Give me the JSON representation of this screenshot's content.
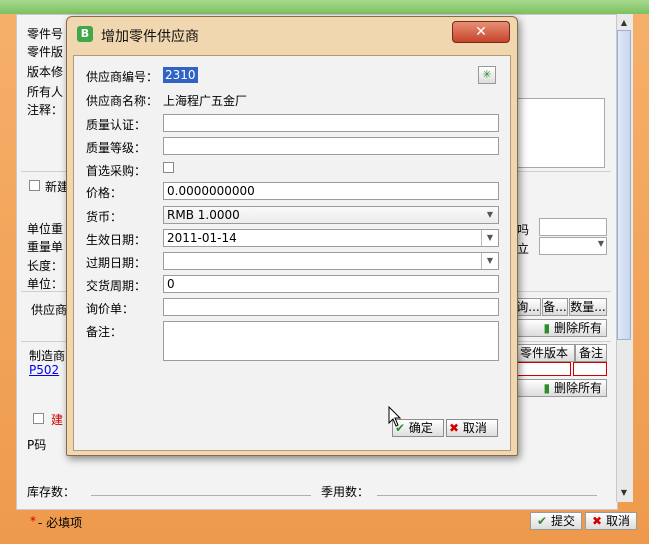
{
  "background": {
    "labels": {
      "part_no": "零件号",
      "part_version": "零件版",
      "version_note": "版本修",
      "owner": "所有人",
      "remark": "注释：",
      "new_build": "新建",
      "unit_weight": "单位重",
      "weight_unit": "重量单",
      "length": "长度：",
      "unit": "单位：",
      "supplier": "供应商",
      "manufacturer": "制造商",
      "build": "建",
      "p_code": "P码",
      "stock_count": "库存数：",
      "season_count": "季用数：",
      "required_note": "- 必填项",
      "required_star": "*",
      "right_label_1": "吗",
      "right_label_2": "立"
    },
    "manufacturer_link": "P502",
    "supplier_table_headers": [
      "询...",
      "备...",
      "数量..."
    ],
    "manufacturer_table_headers": [
      "零件版本",
      "备注"
    ],
    "delete_all_label": "删除所有",
    "delete_all_label_2": "删除所有",
    "submit_label": "提交",
    "cancel_label": "取消"
  },
  "dialog": {
    "icon_text": "B",
    "title": "增加零件供应商",
    "close_symbol": "✕",
    "fields": {
      "supplier_code_label": "供应商编号：",
      "supplier_code_value": "2310",
      "supplier_name_label": "供应商名称：",
      "supplier_name_value": "上海程广五金厂",
      "quality_cert_label": "质量认证：",
      "quality_cert_value": "",
      "quality_grade_label": "质量等级：",
      "quality_grade_value": "",
      "preferred_label": "首选采购：",
      "price_label": "价格：",
      "price_value": "0.0000000000",
      "currency_label": "货币：",
      "currency_value": "RMB 1.0000",
      "effective_date_label": "生效日期：",
      "effective_date_value": "2011-01-14",
      "expiry_date_label": "过期日期：",
      "expiry_date_value": "",
      "lead_time_label": "交货周期：",
      "lead_time_value": "0",
      "inquiry_label": "询价单：",
      "inquiry_value": "",
      "notes_label": "备注：",
      "notes_value": ""
    },
    "confirm_label": "确定",
    "cancel_label": "取消"
  },
  "colors": {
    "accent_orange": "#f1a65a",
    "close_red": "#c5442a",
    "selected_blue": "#3163c5",
    "required_red": "#d00000"
  }
}
